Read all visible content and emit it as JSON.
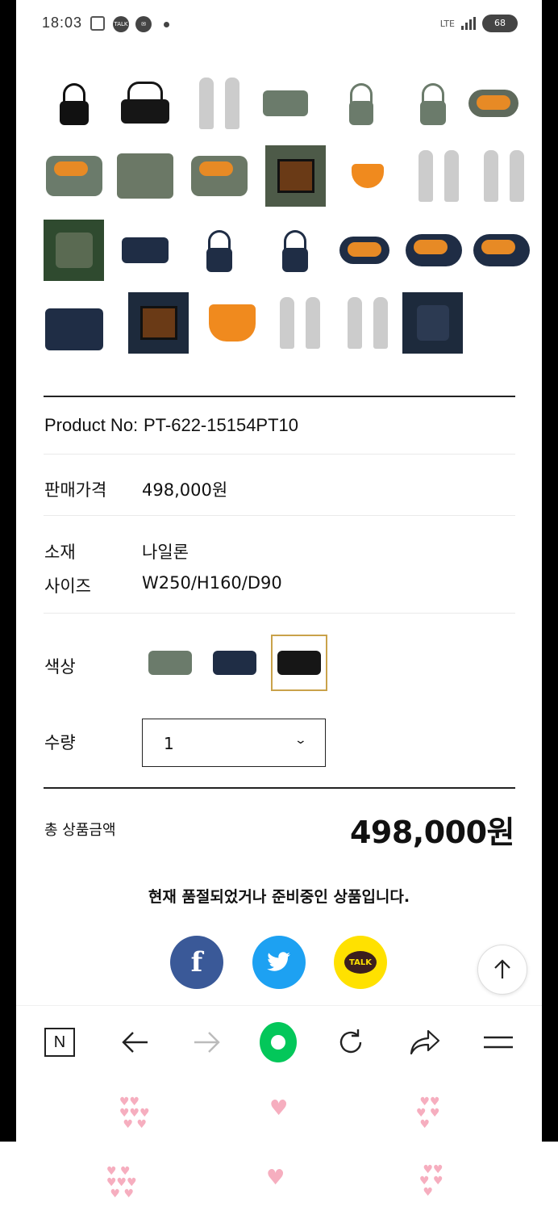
{
  "status_bar": {
    "time": "18:03",
    "network": "LTE",
    "battery": "68"
  },
  "product": {
    "product_no_label": "Product No:",
    "product_no": "PT-622-15154PT10",
    "price_label": "판매가격",
    "price": "498,000원",
    "material_label": "소재",
    "material": "나일론",
    "size_label": "사이즈",
    "size": "W250/H160/D90",
    "color_label": "색상",
    "colors": [
      "sage green",
      "navy",
      "black"
    ],
    "selected_color": "black",
    "quantity_label": "수량",
    "quantity": "1",
    "total_label": "총 상품금액",
    "total": "498,000원",
    "soldout_notice": "현재 품절되었거나 준비중인 상품입니다."
  },
  "share": {
    "facebook": "f",
    "kakao": "TALK"
  },
  "toolbar": {
    "naver_home": "N"
  },
  "colors": {
    "facebook": "#3a5998",
    "twitter": "#1da1f2",
    "kakao": "#ffe100",
    "naver_green": "#03c75a",
    "selected_border": "#c9a24a"
  }
}
